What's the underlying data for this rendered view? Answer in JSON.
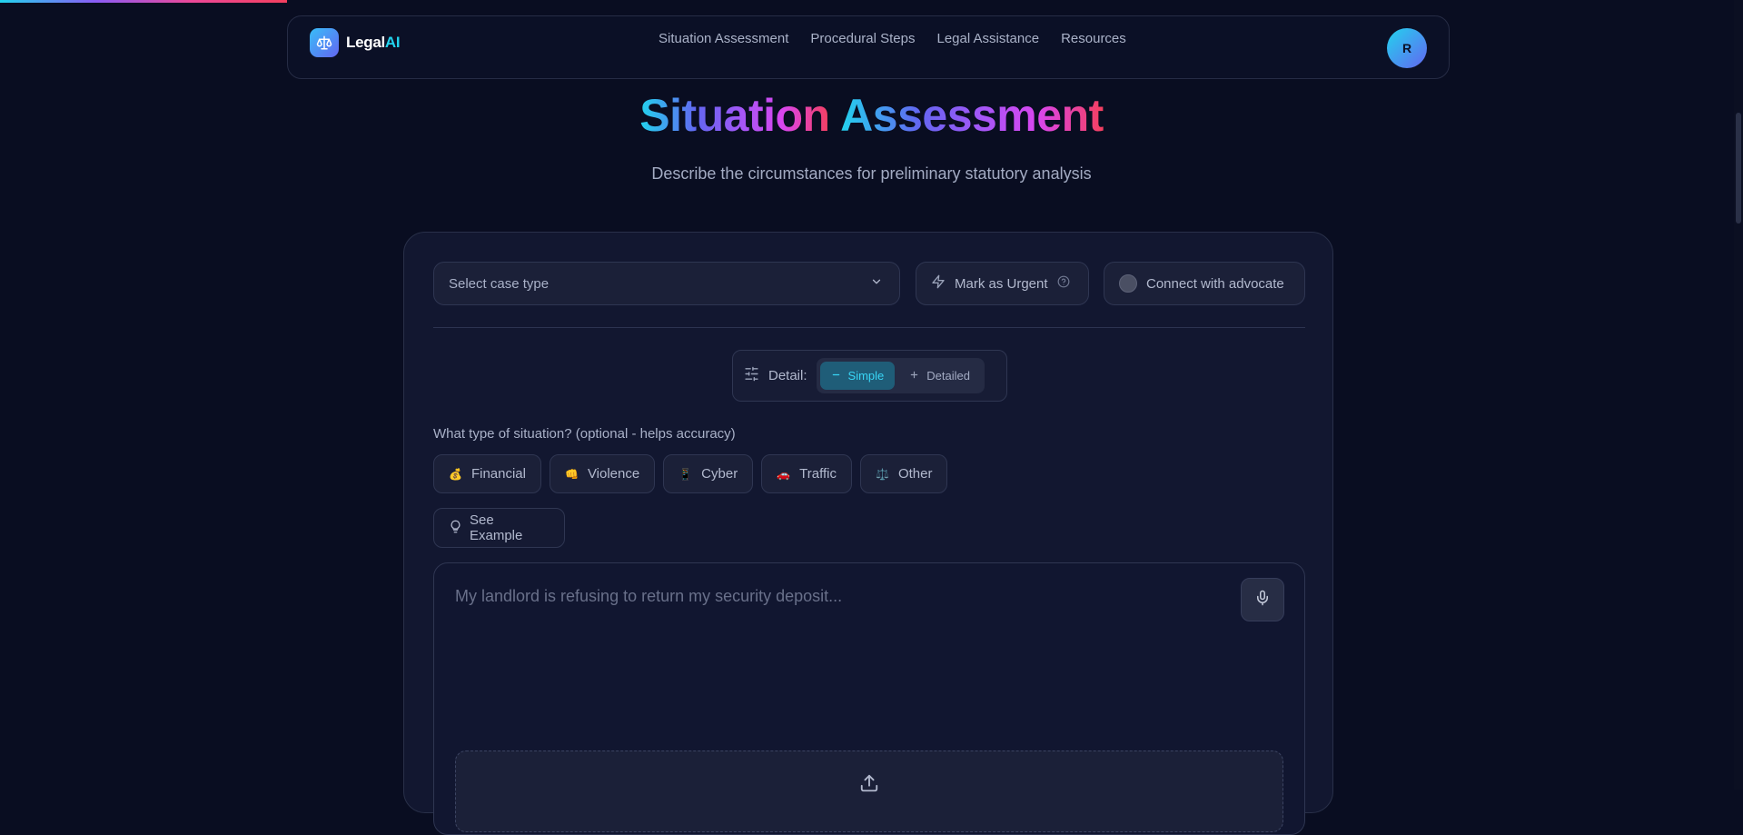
{
  "app": {
    "brand_prefix": "Legal",
    "brand_suffix": "AI",
    "user_initial": "R",
    "accent_colors": [
      "#22d3ee",
      "#6366f1",
      "#a855f7",
      "#f43f5e"
    ]
  },
  "nav": {
    "links": [
      {
        "label": "Situation Assessment"
      },
      {
        "label": "Procedural Steps"
      },
      {
        "label": "Legal Assistance"
      },
      {
        "label": "Resources"
      }
    ]
  },
  "header": {
    "title_part1": "Situation",
    "title_part2": "Assessment",
    "subtitle": "Describe the circumstances for preliminary statutory analysis"
  },
  "form": {
    "case_type_placeholder": "Select case type",
    "urgent_label": "Mark as Urgent",
    "advocate_label": "Connect with advocate",
    "detail": {
      "label": "Detail:",
      "options": [
        {
          "label": "Simple",
          "selected": true
        },
        {
          "label": "Detailed",
          "selected": false
        }
      ]
    },
    "situation_question": "What type of situation? (optional - helps accuracy)",
    "situation_types": [
      {
        "emoji": "💰",
        "label": "Financial"
      },
      {
        "emoji": "👊",
        "label": "Violence"
      },
      {
        "emoji": "📱",
        "label": "Cyber"
      },
      {
        "emoji": "🚗",
        "label": "Traffic"
      },
      {
        "emoji": "⚖️",
        "label": "Other"
      }
    ],
    "example_button": "See Example",
    "description_placeholder": "My landlord is refusing to return my security deposit...",
    "description_value": ""
  },
  "icons": {
    "logo": "scales-icon",
    "dropdown": "chevron-down-icon",
    "urgent": "lightning-icon",
    "help": "help-circle-icon",
    "detail": "sliders-icon",
    "example": "lightbulb-icon",
    "mic": "microphone-icon",
    "upload": "upload-icon"
  }
}
